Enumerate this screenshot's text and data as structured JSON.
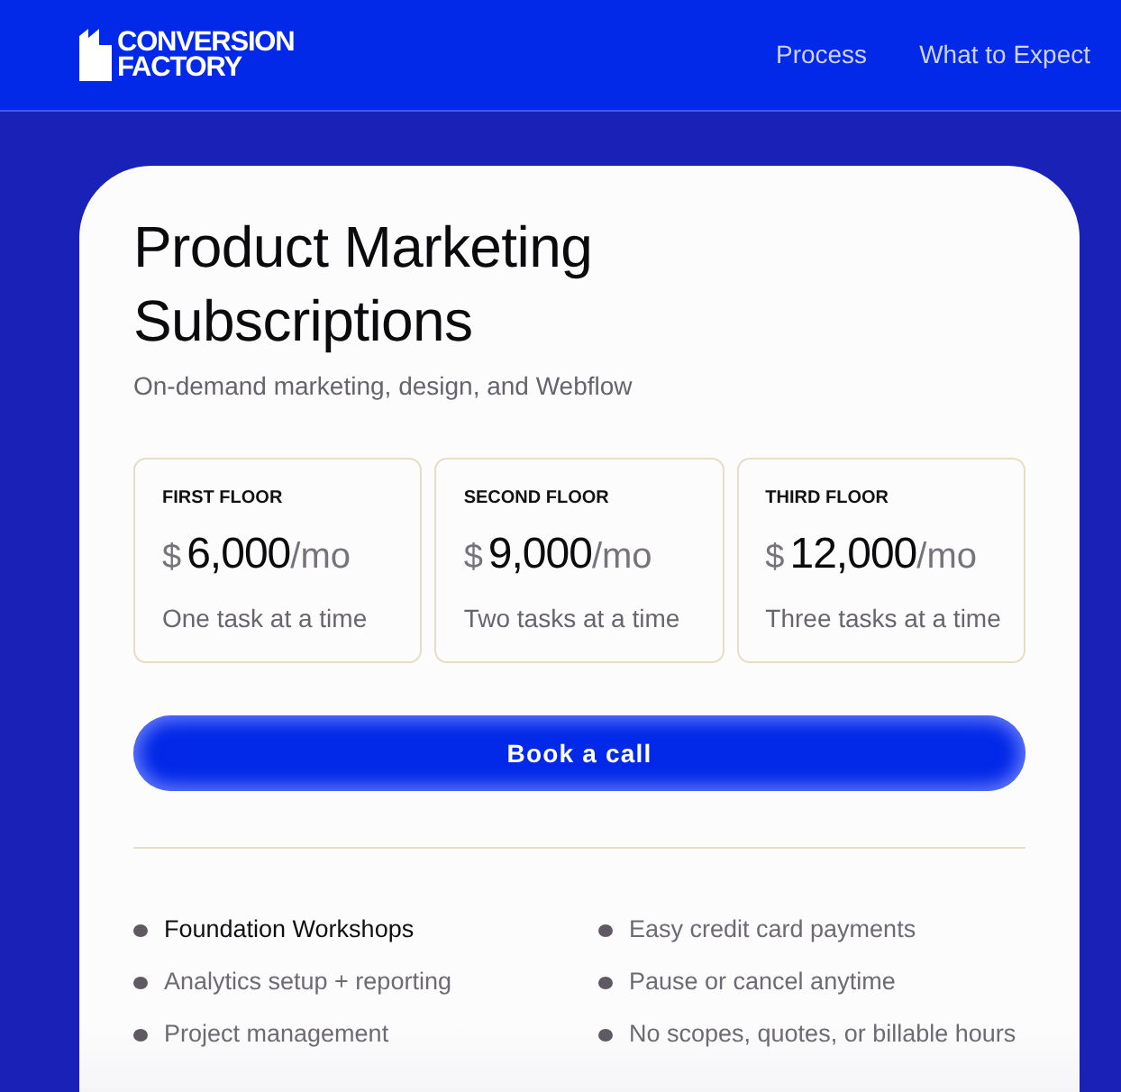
{
  "header": {
    "logo_lines": [
      "CONVERSION",
      "FACTORY"
    ],
    "nav": [
      "Process",
      "What to Expect"
    ]
  },
  "card": {
    "title": "Product Marketing Subscriptions",
    "subtitle": "On-demand marketing, design, and Webflow",
    "plans": [
      {
        "label": "FIRST FLOOR",
        "currency": "$",
        "amount": "6,000",
        "period": "/mo",
        "description": "One task at a time"
      },
      {
        "label": "SECOND FLOOR",
        "currency": "$",
        "amount": "9,000",
        "period": "/mo",
        "description": "Two tasks at a time"
      },
      {
        "label": "THIRD FLOOR",
        "currency": "$",
        "amount": "12,000",
        "period": "/mo",
        "description": "Three tasks at a time"
      }
    ],
    "cta": "Book a call",
    "feature_columns": [
      [
        {
          "text": "Foundation Workshops",
          "highlighted": true
        },
        {
          "text": "Analytics setup + reporting",
          "highlighted": false
        },
        {
          "text": "Project management",
          "highlighted": false
        }
      ],
      [
        {
          "text": "Easy credit card payments",
          "highlighted": false
        },
        {
          "text": "Pause or cancel anytime",
          "highlighted": false
        },
        {
          "text": "No scopes, quotes, or billable hours",
          "highlighted": false
        }
      ]
    ]
  }
}
